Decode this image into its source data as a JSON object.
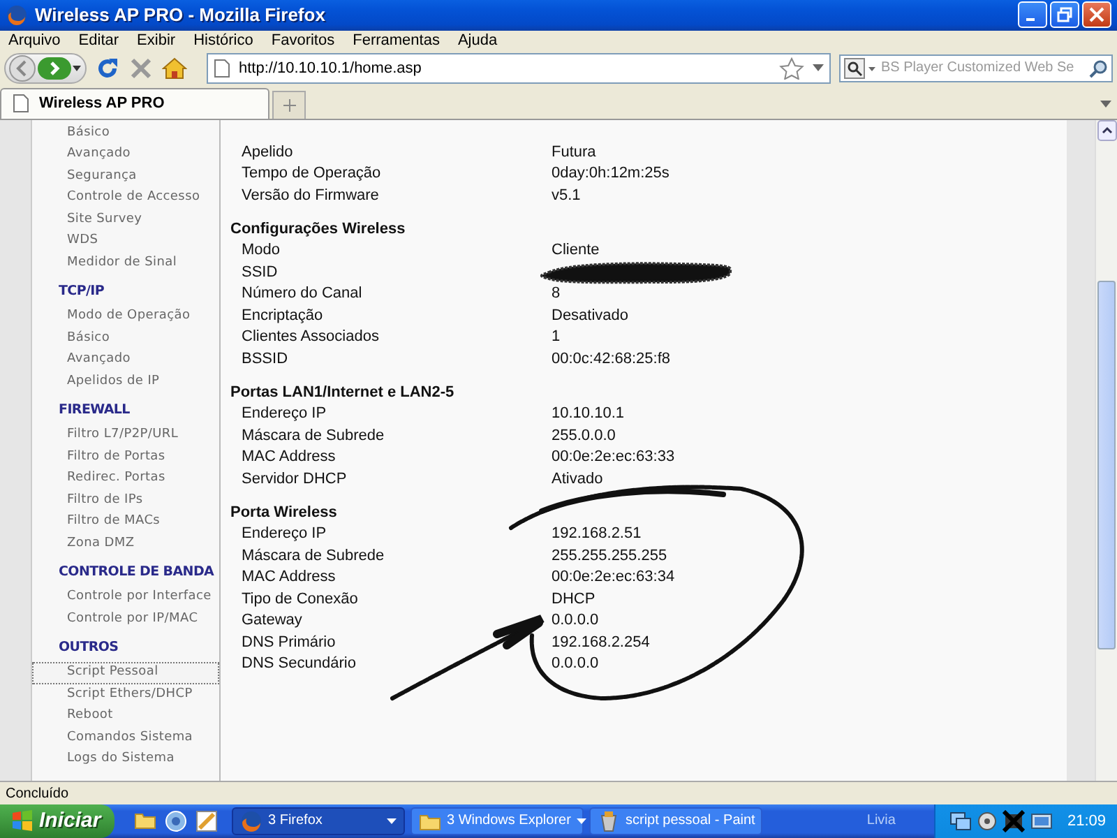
{
  "window": {
    "title": "Wireless AP PRO - Mozilla Firefox"
  },
  "menu": [
    "Arquivo",
    "Editar",
    "Exibir",
    "Histórico",
    "Favoritos",
    "Ferramentas",
    "Ajuda"
  ],
  "toolbar": {
    "url": "http://10.10.10.1/home.asp",
    "search_placeholder": "BS Player Customized Web Se"
  },
  "tabs": [
    {
      "label": "Wireless AP PRO",
      "selected": true
    }
  ],
  "sidebar": {
    "groups": [
      {
        "items": [
          {
            "label": "Básico",
            "selected": false
          },
          {
            "label": "Avançado",
            "selected": false
          },
          {
            "label": "Segurança",
            "selected": false
          },
          {
            "label": "Controle de Accesso",
            "selected": false
          },
          {
            "label": "Site Survey",
            "selected": false
          },
          {
            "label": "WDS",
            "selected": false
          },
          {
            "label": "Medidor de Sinal",
            "selected": false
          }
        ]
      },
      {
        "title": "TCP/IP",
        "items": [
          {
            "label": "Modo de Operação",
            "selected": false
          },
          {
            "label": "Básico",
            "selected": false
          },
          {
            "label": "Avançado",
            "selected": false
          },
          {
            "label": "Apelidos de IP",
            "selected": false
          }
        ]
      },
      {
        "title": "FIREWALL",
        "items": [
          {
            "label": "Filtro L7/P2P/URL",
            "selected": false
          },
          {
            "label": "Filtro de Portas",
            "selected": false
          },
          {
            "label": "Redirec. Portas",
            "selected": false
          },
          {
            "label": "Filtro de IPs",
            "selected": false
          },
          {
            "label": "Filtro de MACs",
            "selected": false
          },
          {
            "label": "Zona DMZ",
            "selected": false
          }
        ]
      },
      {
        "title": "CONTROLE DE BANDA",
        "items": [
          {
            "label": "Controle por Interface",
            "selected": false
          },
          {
            "label": "Controle por IP/MAC",
            "selected": false
          }
        ]
      },
      {
        "title": "OUTROS",
        "items": [
          {
            "label": "Script Pessoal",
            "selected": true
          },
          {
            "label": "Script Ethers/DHCP",
            "selected": false
          },
          {
            "label": "Reboot",
            "selected": false
          },
          {
            "label": "Comandos Sistema",
            "selected": false
          },
          {
            "label": "Logs do Sistema",
            "selected": false
          }
        ]
      }
    ]
  },
  "content": {
    "sections": [
      {
        "rows": [
          {
            "label": "Apelido",
            "value": "Futura"
          },
          {
            "label": "Tempo de Operação",
            "value": "0day:0h:12m:25s"
          },
          {
            "label": "Versão do Firmware",
            "value": "v5.1"
          }
        ]
      },
      {
        "title": "Configurações Wireless",
        "rows": [
          {
            "label": "Modo",
            "value": "Cliente"
          },
          {
            "label": "SSID",
            "redacted": true
          },
          {
            "label": "Número do Canal",
            "value": "8"
          },
          {
            "label": "Encriptação",
            "value": "Desativado"
          },
          {
            "label": "Clientes Associados",
            "value": "1"
          },
          {
            "label": "BSSID",
            "value": "00:0c:42:68:25:f8"
          }
        ]
      },
      {
        "title": "Portas LAN1/Internet e LAN2-5",
        "rows": [
          {
            "label": "Endereço IP",
            "value": "10.10.10.1"
          },
          {
            "label": "Máscara de Subrede",
            "value": "255.0.0.0"
          },
          {
            "label": "MAC Address",
            "value": "00:0e:2e:ec:63:33"
          },
          {
            "label": "Servidor DHCP",
            "value": "Ativado"
          }
        ]
      },
      {
        "title": "Porta Wireless",
        "rows": [
          {
            "label": "Endereço IP",
            "value": "192.168.2.51"
          },
          {
            "label": "Máscara de Subrede",
            "value": "255.255.255.255"
          },
          {
            "label": "MAC Address",
            "value": "00:0e:2e:ec:63:34"
          },
          {
            "label": "Tipo de Conexão",
            "value": "DHCP"
          },
          {
            "label": "Gateway",
            "value": "0.0.0.0"
          },
          {
            "label": "DNS Primário",
            "value": "192.168.2.254"
          },
          {
            "label": "DNS Secundário",
            "value": "0.0.0.0"
          }
        ]
      }
    ]
  },
  "status_bar": "Concluído",
  "taskbar": {
    "start": "Iniciar",
    "tasks": [
      {
        "label": "3 Firefox",
        "kind": "firefox",
        "grouped": true,
        "selected": true
      },
      {
        "label": "3 Windows Explorer",
        "kind": "folder",
        "grouped": true,
        "selected": false
      },
      {
        "label": "script pessoal - Paint",
        "kind": "paint",
        "grouped": false,
        "selected": false
      }
    ],
    "toolbar_label": "Livia",
    "clock": "21:09"
  }
}
